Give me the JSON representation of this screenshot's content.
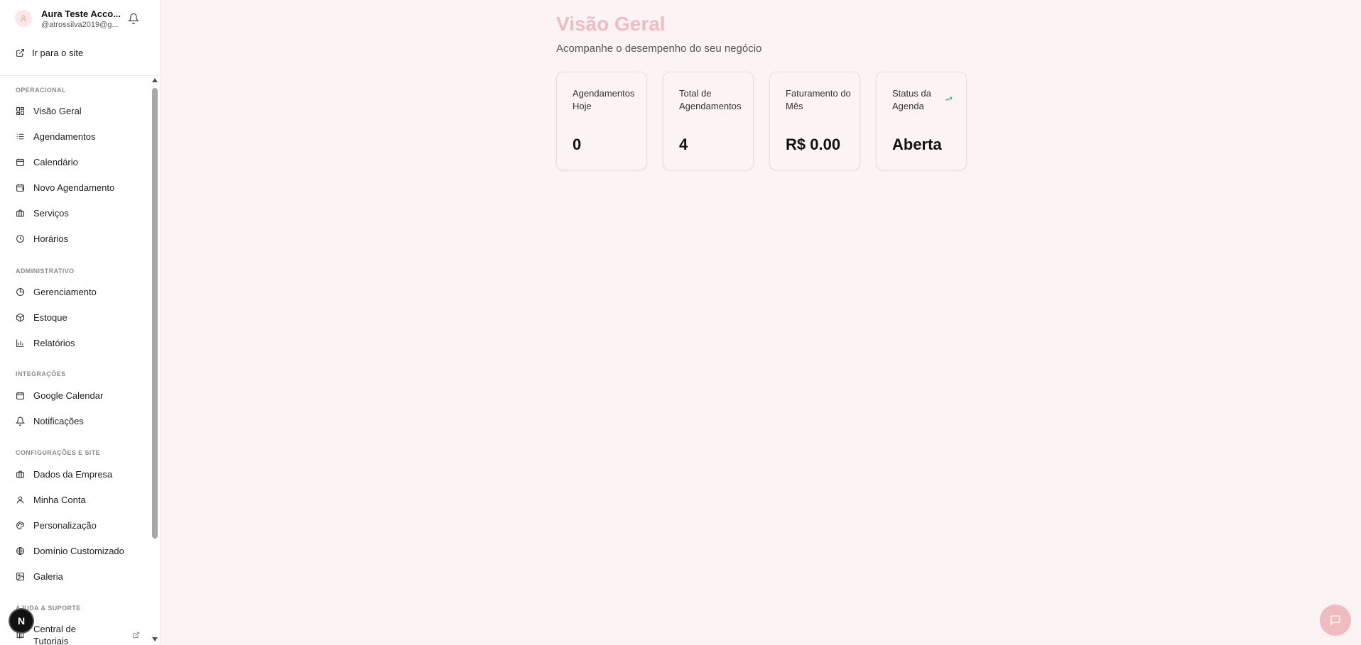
{
  "profile": {
    "name": "Aura Teste Acco...",
    "email": "@atrossilva2019@g..."
  },
  "sidebar": {
    "site_link": "Ir para o site",
    "sections": {
      "operacional": "OPERACIONAL",
      "administrativo": "ADMINISTRATIVO",
      "integracoes": "INTEGRAÇÕES",
      "config": "CONFIGURAÇÕES E SITE",
      "ajuda": "AJUDA & SUPORTE"
    },
    "items": {
      "visao_geral": "Visão Geral",
      "agendamentos": "Agendamentos",
      "calendario": "Calendário",
      "novo_agendamento": "Novo Agendamento",
      "servicos": "Serviços",
      "horarios": "Horários",
      "gerenciamento": "Gerenciamento",
      "estoque": "Estoque",
      "relatorios": "Relatórios",
      "google_calendar": "Google Calendar",
      "notificacoes": "Notificações",
      "dados_empresa": "Dados da Empresa",
      "minha_conta": "Minha Conta",
      "personalizacao": "Personalização",
      "dominio": "Domínio Customizado",
      "galeria": "Galeria",
      "tutoriais": "Central de Tutoriais"
    },
    "next_badge": "N"
  },
  "main": {
    "title": "Visão Geral",
    "subtitle": "Acompanhe o desempenho do seu negócio",
    "cards": [
      {
        "label": "Agendamentos Hoje",
        "value": "0"
      },
      {
        "label": "Total de Agendamentos",
        "value": "4"
      },
      {
        "label": "Faturamento do Mês",
        "value": "R$ 0.00"
      },
      {
        "label": "Status da Agenda",
        "value": "Aberta"
      }
    ]
  },
  "colors": {
    "accent": "#efbcc0",
    "background": "#fcf3f4",
    "trend": "#3cb371"
  },
  "icons": {
    "trend": "trending-up-icon",
    "chat": "chat-icon",
    "bell": "bell-icon"
  }
}
